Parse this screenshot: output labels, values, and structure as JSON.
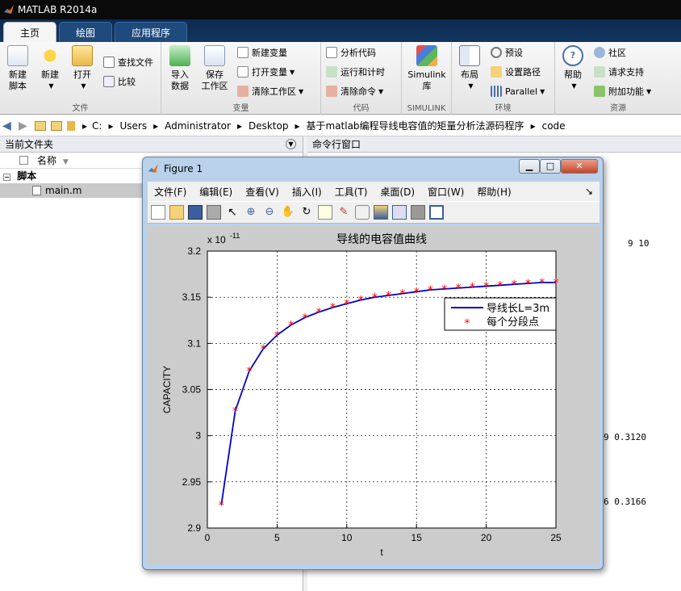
{
  "app": {
    "title": "MATLAB R2014a"
  },
  "tabs": [
    {
      "label": "主页"
    },
    {
      "label": "绘图"
    },
    {
      "label": "应用程序"
    }
  ],
  "ribbon": {
    "groups": {
      "file": "文件",
      "variable": "变量",
      "code": "代码",
      "simulink": "SIMULINK",
      "env": "环境",
      "resources": "资源"
    },
    "new_script": "新建\n脚本",
    "new_script_l1": "新建",
    "new_script_l2": "脚本",
    "new": "新建",
    "open": "打开",
    "find_files": "查找文件",
    "compare": "比较",
    "import_l1": "导入",
    "import_l2": "数据",
    "save_l1": "保存",
    "save_l2": "工作区",
    "new_variable": "新建变量",
    "open_variable": "打开变量",
    "clear_workspace": "清除工作区",
    "analyze_code": "分析代码",
    "run_and_time": "运行和计时",
    "clear_commands": "清除命令",
    "simulink_l1": "Simulink",
    "simulink_l2": "库",
    "layout": "布局",
    "preferences": "预设",
    "set_path": "设置路径",
    "parallel": "Parallel",
    "help": "帮助",
    "community": "社区",
    "request_support": "请求支持",
    "addons": "附加功能"
  },
  "address": {
    "path": [
      "C:",
      "Users",
      "Administrator",
      "Desktop",
      "基于matlab编程导线电容值的矩量分析法源码程序",
      "code"
    ]
  },
  "current_folder": {
    "title": "当前文件夹",
    "column": "名称",
    "group": "脚本",
    "file": "main.m"
  },
  "command_window": {
    "title": "命令行窗口",
    "outputs": [
      "9     10",
      "9    0.3120",
      "6    0.3166"
    ]
  },
  "figure": {
    "title": "Figure 1",
    "menu": [
      "文件(F)",
      "编辑(E)",
      "查看(V)",
      "插入(I)",
      "工具(T)",
      "桌面(D)",
      "窗口(W)",
      "帮助(H)"
    ],
    "menu_arrow": "↘"
  },
  "chart_data": {
    "type": "line",
    "title": "导线的电容值曲线",
    "xlabel": "t",
    "ylabel": "CAPACITY",
    "y_exponent": "x 10",
    "y_exponent_power": "-11",
    "xlim": [
      0,
      25
    ],
    "ylim": [
      2.9,
      3.2
    ],
    "xticks": [
      0,
      5,
      10,
      15,
      20,
      25
    ],
    "yticks": [
      2.9,
      2.95,
      3.0,
      3.05,
      3.1,
      3.15,
      3.2
    ],
    "xtick_labels": [
      "0",
      "5",
      "10",
      "15",
      "20",
      "25"
    ],
    "ytick_labels": [
      "2.9",
      "2.95",
      "3",
      "3.05",
      "3.1",
      "3.15",
      "3.2"
    ],
    "grid": true,
    "legend_position": "upper-right",
    "x": [
      1,
      2,
      3,
      4,
      5,
      6,
      7,
      8,
      9,
      10,
      11,
      12,
      13,
      14,
      15,
      16,
      17,
      18,
      19,
      20,
      21,
      22,
      23,
      24,
      25
    ],
    "series": [
      {
        "name": "导线长L=3m",
        "style": "line",
        "color": "#0000cc",
        "values": [
          2.925,
          3.027,
          3.07,
          3.094,
          3.109,
          3.12,
          3.128,
          3.134,
          3.139,
          3.143,
          3.147,
          3.15,
          3.152,
          3.154,
          3.156,
          3.158,
          3.159,
          3.16,
          3.161,
          3.162,
          3.163,
          3.164,
          3.165,
          3.166,
          3.166
        ]
      },
      {
        "name": "每个分段点",
        "style": "marker",
        "marker": "*",
        "color": "#ff0000",
        "values": [
          2.925,
          3.027,
          3.07,
          3.094,
          3.109,
          3.12,
          3.128,
          3.134,
          3.139,
          3.143,
          3.147,
          3.15,
          3.152,
          3.154,
          3.156,
          3.158,
          3.159,
          3.16,
          3.161,
          3.162,
          3.163,
          3.164,
          3.165,
          3.166,
          3.166
        ]
      }
    ]
  }
}
